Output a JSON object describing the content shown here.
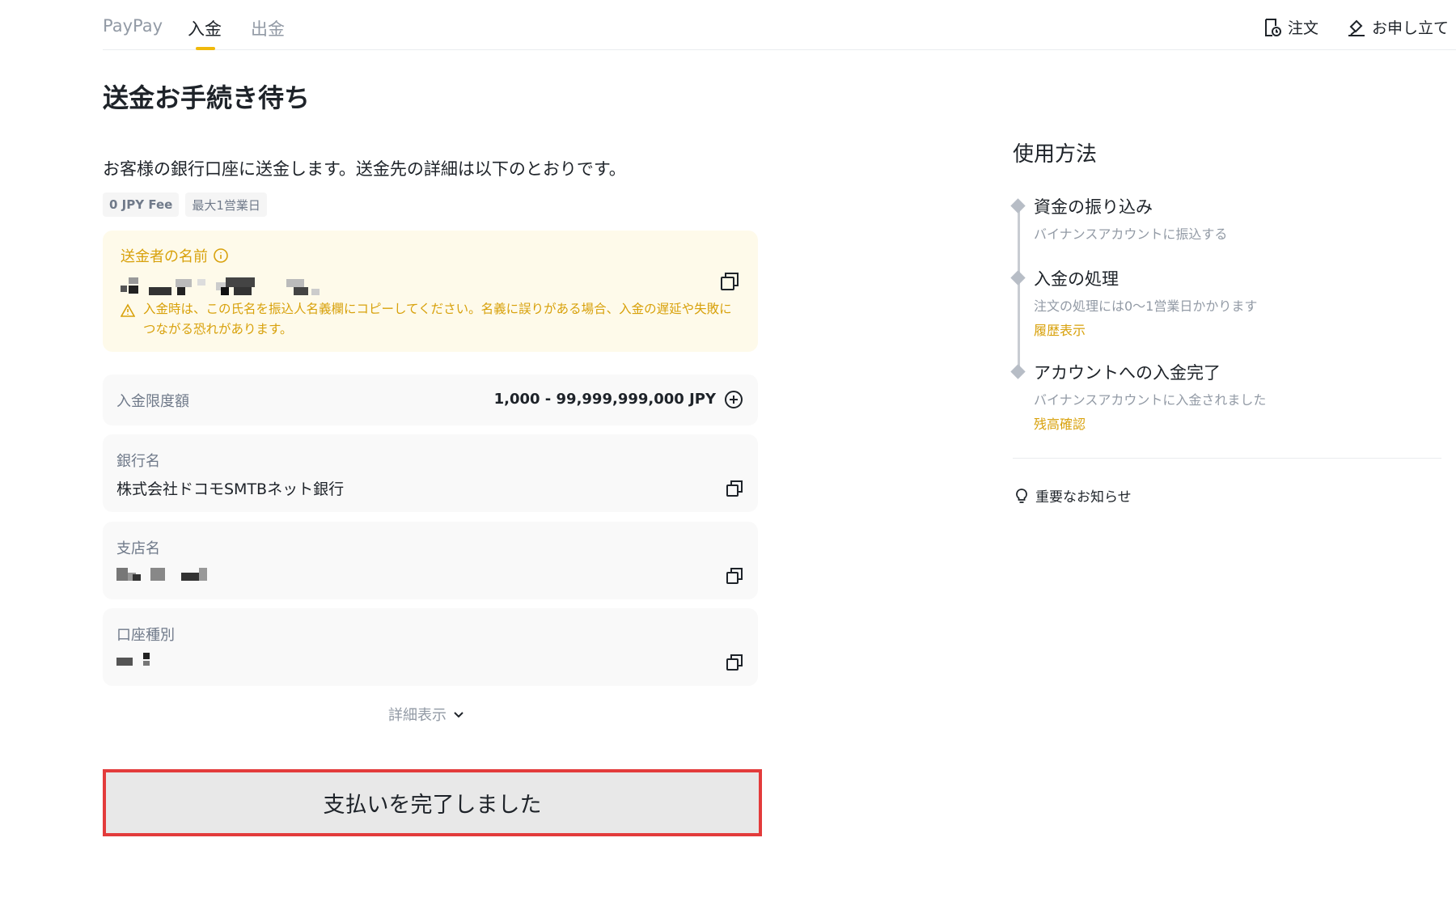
{
  "tabs": [
    {
      "label": "PayPay",
      "active": false
    },
    {
      "label": "入金",
      "active": true
    },
    {
      "label": "出金",
      "active": false
    }
  ],
  "top_actions": {
    "orders_label": "注文",
    "appeal_label": "お申し立て"
  },
  "page_title": "送金お手続き待ち",
  "intro_text": "お客様の銀行口座に送金します。送金先の詳細は以下のとおりです。",
  "tags": {
    "fee_label": "0 JPY Fee",
    "time_label": "最大1営業日"
  },
  "sender": {
    "label": "送金者の名前",
    "warning": "入金時は、この氏名を振込人名義欄にコピーしてください。名義に誤りがある場合、入金の遅延や失敗につながる恐れがあります。"
  },
  "deposit_limit": {
    "label": "入金限度額",
    "value": "1,000 - 99,999,999,000 JPY"
  },
  "bank": {
    "label": "銀行名",
    "value": "株式会社ドコモSMTBネット銀行"
  },
  "branch": {
    "label": "支店名"
  },
  "account_type": {
    "label": "口座種別"
  },
  "details_toggle_label": "詳細表示",
  "confirm_button_label": "支払いを完了しました",
  "howto": {
    "title": "使用方法",
    "steps": [
      {
        "title": "資金の振り込み",
        "desc": "バイナンスアカウントに振込する"
      },
      {
        "title": "入金の処理",
        "desc": "注文の処理には0〜1営業日かかります",
        "link": "履歴表示"
      },
      {
        "title": "アカウントへの入金完了",
        "desc": "バイナンスアカウントに入金されました",
        "link": "残高確認"
      }
    ]
  },
  "notice_label": "重要なお知らせ",
  "colors": {
    "accent": "#f0b90b",
    "warning_text": "#d8a10b",
    "highlight_border": "#e33b3b"
  },
  "icons": [
    "order-icon",
    "appeal-icon",
    "info-icon",
    "copy-icon",
    "warning-icon",
    "plus-circle-icon",
    "chevron-down-icon",
    "lightbulb-icon"
  ]
}
